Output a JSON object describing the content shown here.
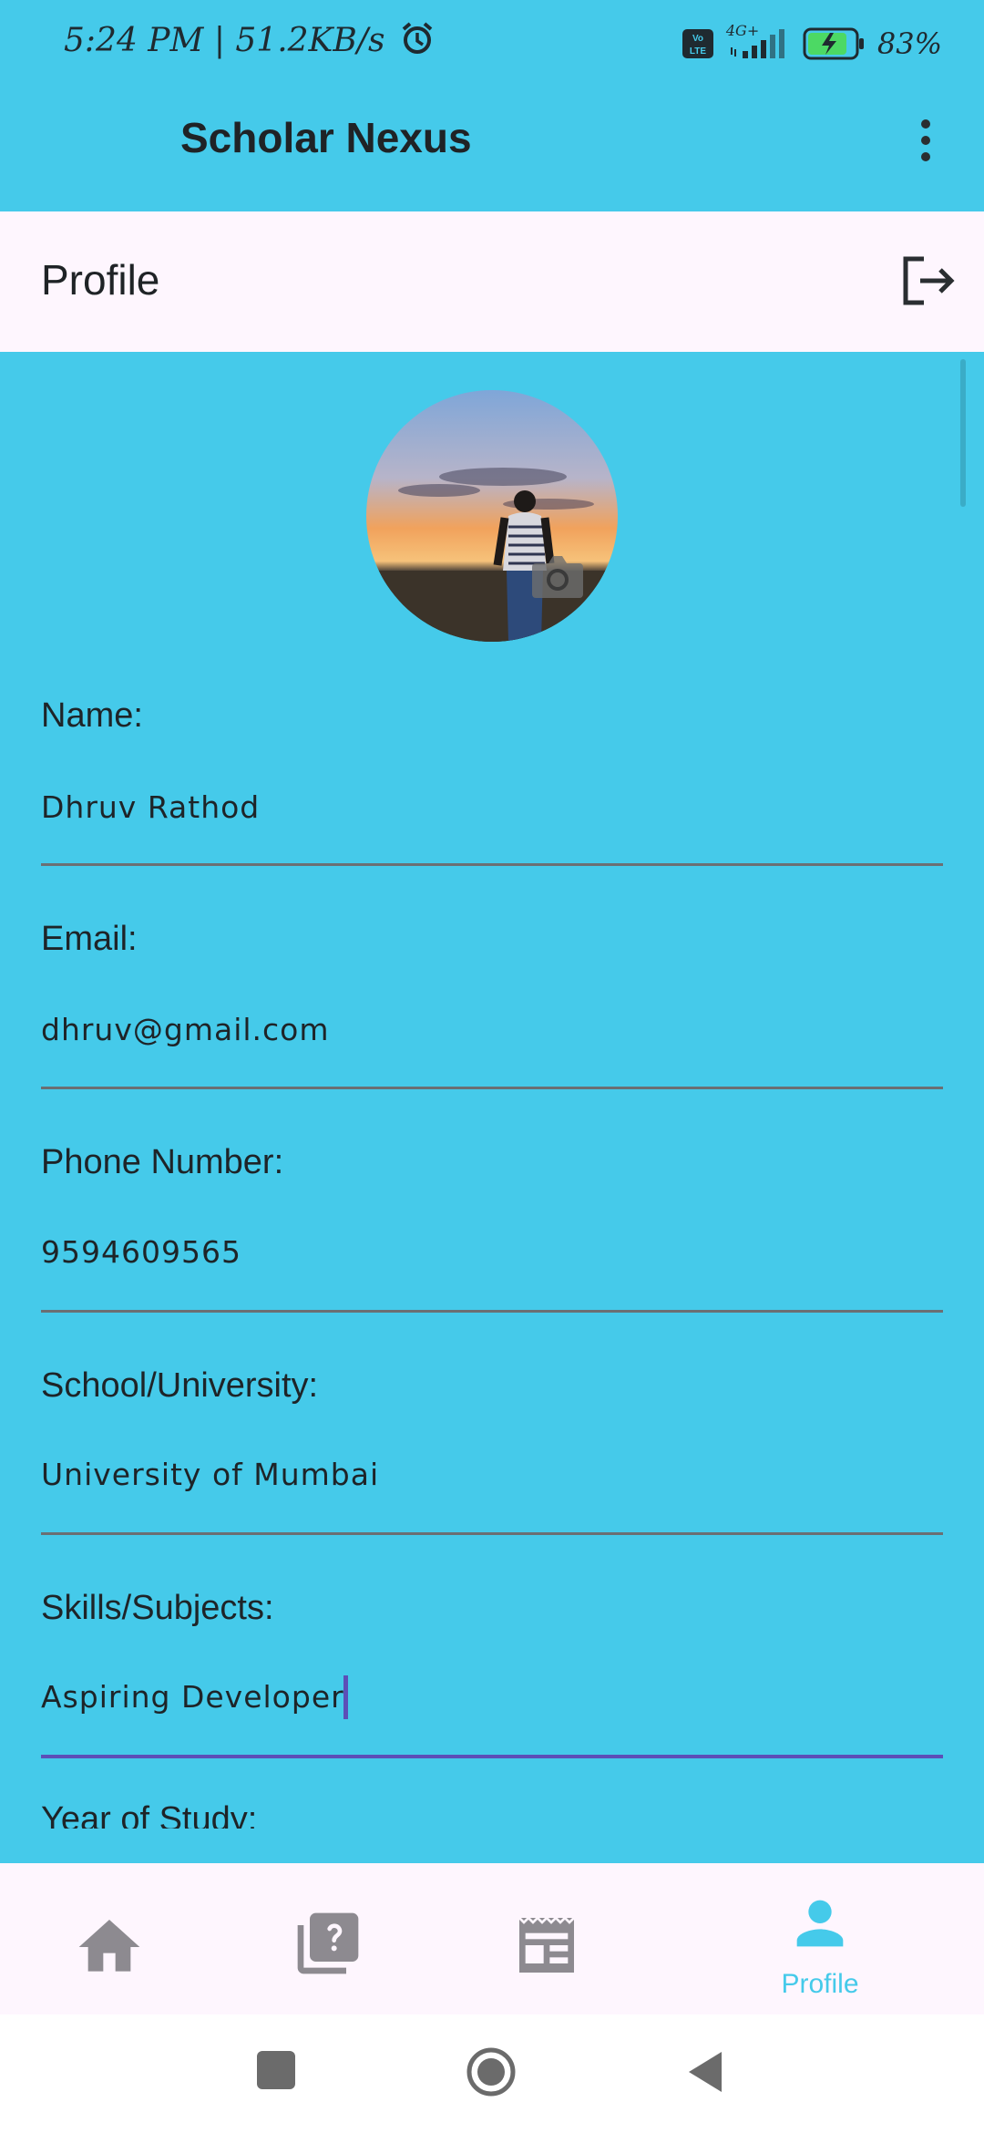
{
  "status_bar": {
    "left_text": "5:24 PM | 51.2KB/s",
    "network": "4G+",
    "volte": "Vo LTE",
    "battery_percent": "83%",
    "icons": [
      "alarm-icon",
      "volte-icon",
      "signal-icon",
      "battery-charging-icon"
    ]
  },
  "app_bar": {
    "title": "Scholar Nexus",
    "menu_icon": "more-vert-icon"
  },
  "profile_header": {
    "title": "Profile",
    "logout_icon": "logout-icon"
  },
  "avatar": {
    "photo": "sunset-person-photo",
    "edit_icon": "camera-icon"
  },
  "fields": [
    {
      "label": "Name:",
      "value": "Dhruv Rathod"
    },
    {
      "label": "Email:",
      "value": "dhruv@gmail.com"
    },
    {
      "label": "Phone Number:",
      "value": "9594609565"
    },
    {
      "label": "School/University:",
      "value": "University of Mumbai"
    },
    {
      "label": "Skills/Subjects:",
      "value": "Aspiring Developer",
      "focused": true
    },
    {
      "label": "Year of Study:"
    }
  ],
  "bottom_nav": {
    "items": [
      {
        "icon": "home-icon"
      },
      {
        "icon": "quiz-icon"
      },
      {
        "icon": "newspaper-icon"
      },
      {
        "icon": "person-icon",
        "label": "Profile",
        "selected": true
      }
    ]
  },
  "colors": {
    "background": "#45CAEA",
    "surface": "#FEF6FE",
    "focus_accent": "#5C4FB7",
    "nav_inactive": "#8D8A90",
    "nav_active": "#45CAEA"
  }
}
